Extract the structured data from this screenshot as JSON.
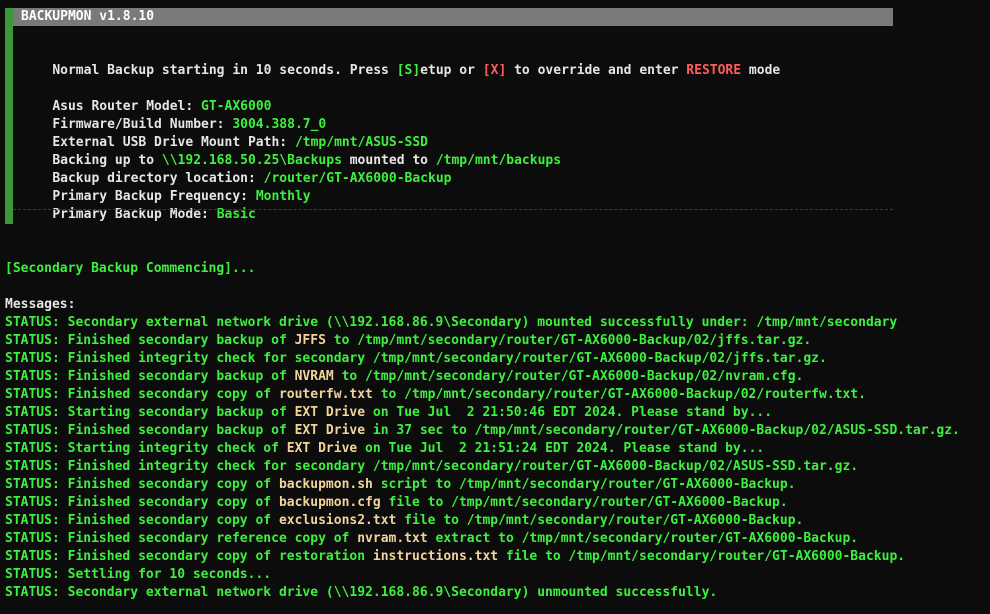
{
  "title": "BACKUPMON v1.8.10",
  "notice": {
    "prefix": "Normal Backup starting in 10 seconds. Press ",
    "setup_key": "[S]",
    "middle": "etup or ",
    "override_key": "[X]",
    "suffix_pre": " to override and enter ",
    "restore_word": "RESTORE",
    "suffix_post": " mode"
  },
  "info": [
    {
      "label": "Asus Router Model: ",
      "value": "GT-AX6000"
    },
    {
      "label": "Firmware/Build Number: ",
      "value": "3004.388.7_0"
    },
    {
      "label": "External USB Drive Mount Path: ",
      "value": "/tmp/mnt/ASUS-SSD"
    },
    {
      "label": "Backup directory location: ",
      "value": "/router/GT-AX6000-Backup"
    },
    {
      "label": "Primary Backup Frequency: ",
      "value": "Monthly"
    },
    {
      "label": "Primary Backup Mode: ",
      "value": "Basic"
    }
  ],
  "backing_up": {
    "label": "Backing up to ",
    "source": "\\\\192.168.50.25\\Backups",
    "middle": " mounted to ",
    "target": "/tmp/mnt/backups"
  },
  "secondary_header": "[Secondary Backup Commencing]...",
  "messages_label": "Messages:",
  "status_prefix": "STATUS: ",
  "messages": [
    {
      "a": "Secondary external network drive (\\\\192.168.86.9\\Secondary) mounted successfully under: /tmp/mnt/secondary",
      "hl": "",
      "b": ""
    },
    {
      "a": "Finished secondary backup of ",
      "hl": "JFFS",
      "b": " to /tmp/mnt/secondary/router/GT-AX6000-Backup/02/jffs.tar.gz."
    },
    {
      "a": "Finished integrity check for secondary /tmp/mnt/secondary/router/GT-AX6000-Backup/02/jffs.tar.gz.",
      "hl": "",
      "b": ""
    },
    {
      "a": "Finished secondary backup of ",
      "hl": "NVRAM",
      "b": " to /tmp/mnt/secondary/router/GT-AX6000-Backup/02/nvram.cfg."
    },
    {
      "a": "Finished secondary copy of ",
      "hl": "routerfw.txt",
      "b": " to /tmp/mnt/secondary/router/GT-AX6000-Backup/02/routerfw.txt."
    },
    {
      "a": "Starting secondary backup of ",
      "hl": "EXT Drive",
      "b": " on Tue Jul  2 21:50:46 EDT 2024. Please stand by..."
    },
    {
      "a": "Finished secondary backup of ",
      "hl": "EXT Drive",
      "b": " in 37 sec to /tmp/mnt/secondary/router/GT-AX6000-Backup/02/ASUS-SSD.tar.gz."
    },
    {
      "a": "Starting integrity check of ",
      "hl": "EXT Drive",
      "b": " on Tue Jul  2 21:51:24 EDT 2024. Please stand by..."
    },
    {
      "a": "Finished integrity check for secondary /tmp/mnt/secondary/router/GT-AX6000-Backup/02/ASUS-SSD.tar.gz.",
      "hl": "",
      "b": ""
    },
    {
      "a": "Finished secondary copy of ",
      "hl": "backupmon.sh",
      "b": " script to /tmp/mnt/secondary/router/GT-AX6000-Backup."
    },
    {
      "a": "Finished secondary copy of ",
      "hl": "backupmon.cfg",
      "b": " file to /tmp/mnt/secondary/router/GT-AX6000-Backup."
    },
    {
      "a": "Finished secondary copy of ",
      "hl": "exclusions2.txt",
      "b": " file to /tmp/mnt/secondary/router/GT-AX6000-Backup."
    },
    {
      "a": "Finished secondary reference copy of ",
      "hl": "nvram.txt",
      "b": " extract to /tmp/mnt/secondary/router/GT-AX6000-Backup."
    },
    {
      "a": "Finished secondary copy of restoration ",
      "hl": "instructions.txt",
      "b": " file to /tmp/mnt/secondary/router/GT-AX6000-Backup."
    },
    {
      "a": "Settling for 10 seconds...",
      "hl": "",
      "b": ""
    },
    {
      "a": "Secondary external network drive (\\\\192.168.86.9\\Secondary) unmounted successfully.",
      "hl": "",
      "b": ""
    }
  ],
  "colors": {
    "background": "#0c0c0c",
    "text": "#e6e6e6",
    "green": "#3ef03e",
    "yellow": "#f3f07a",
    "red": "#ff5c5c",
    "highlight": "#f1d49a",
    "title_bar": "#7a7a7a",
    "side_bar": "#3a9a3a"
  }
}
